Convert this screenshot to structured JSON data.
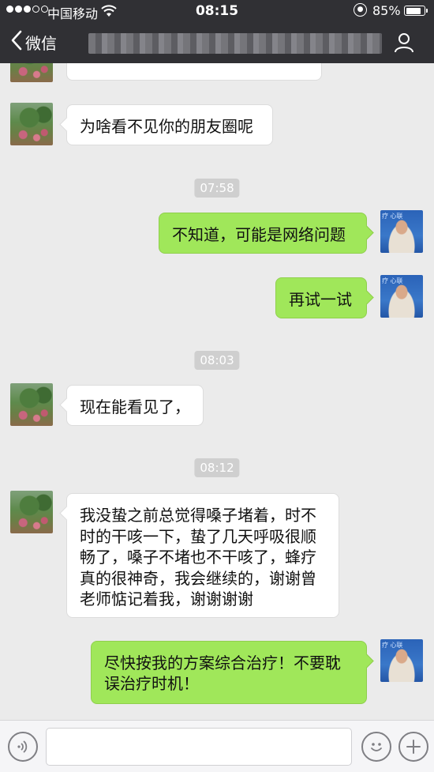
{
  "status_bar": {
    "carrier": "中国移动",
    "time": "08:15",
    "battery": "85%",
    "battery_level": 0.85,
    "signal_bars": 3,
    "signal_total": 5
  },
  "nav": {
    "back_label": "微信"
  },
  "messages": [
    {
      "side": "in",
      "text": "为啥看不见你的朋友圈呢"
    },
    {
      "type": "time",
      "text": "07:58"
    },
    {
      "side": "out",
      "text": "不知道，可能是网络问题"
    },
    {
      "side": "out",
      "text": "再试一试"
    },
    {
      "type": "time",
      "text": "08:03"
    },
    {
      "side": "in",
      "text": "现在能看见了，"
    },
    {
      "type": "time",
      "text": "08:12"
    },
    {
      "side": "in",
      "lines": [
        "我没蛰之前总觉得嗓子堵着，时不",
        "时的干咳一下，蛰了几天呼吸很顺",
        "畅了，嗓子不堵也不干咳了，蜂疗",
        "真的很神奇，我会继续的，谢谢曾",
        "老师惦记着我，谢谢谢谢"
      ]
    },
    {
      "side": "out",
      "lines": [
        "尽快按我的方案综合治疗！不要耽",
        "误治疗时机！"
      ]
    }
  ],
  "icons": {
    "back": "chevron-left-icon",
    "profile": "person-icon",
    "voice": "voice-icon",
    "emoji": "emoji-icon",
    "plus": "plus-icon"
  },
  "colors": {
    "nav_bg": "#303034",
    "chat_bg": "#ebebeb",
    "bubble_out": "#a0e75a",
    "bubble_in": "#ffffff",
    "time_pill": "#cfcfcf"
  }
}
